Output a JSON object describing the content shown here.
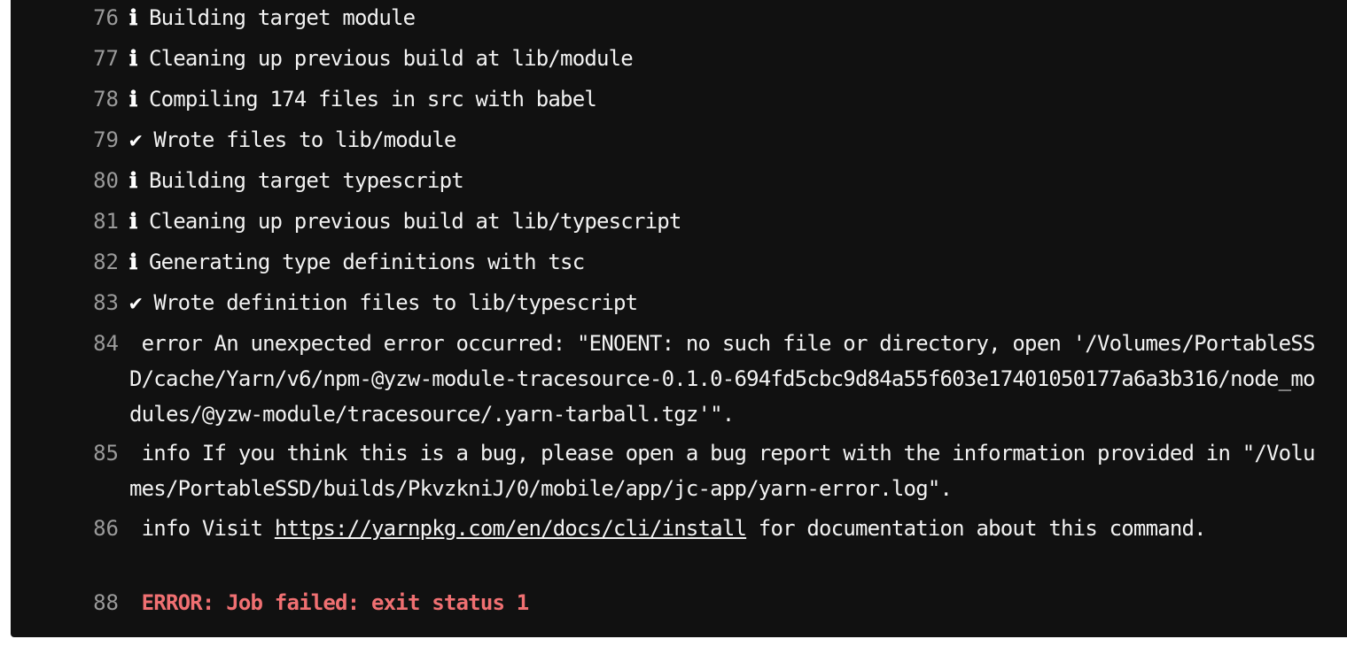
{
  "log": {
    "lines": [
      {
        "num": "76",
        "icon": "ℹ",
        "text": "Building target module"
      },
      {
        "num": "77",
        "icon": "ℹ",
        "text": "Cleaning up previous build at lib/module"
      },
      {
        "num": "78",
        "icon": "ℹ",
        "text": "Compiling 174 files in src with babel"
      },
      {
        "num": "79",
        "icon": "✔",
        "text": "Wrote files to lib/module"
      },
      {
        "num": "80",
        "icon": "ℹ",
        "text": "Building target typescript"
      },
      {
        "num": "81",
        "icon": "ℹ",
        "text": "Cleaning up previous build at lib/typescript"
      },
      {
        "num": "82",
        "icon": "ℹ",
        "text": "Generating type definitions with tsc"
      },
      {
        "num": "83",
        "icon": "✔",
        "text": "Wrote definition files to lib/typescript"
      },
      {
        "num": "84",
        "text": " error An unexpected error occurred: \"ENOENT: no such file or directory, open '/Volumes/PortableSSD/cache/Yarn/v6/npm-@yzw-module-tracesource-0.1.0-694fd5cbc9d84a55f603e17401050177a6a3b316/node_modules/@yzw-module/tracesource/.yarn-tarball.tgz'\"."
      },
      {
        "num": "85",
        "text": " info If you think this is a bug, please open a bug report with the information provided in \"/Volumes/PortableSSD/builds/PkvzkniJ/0/mobile/app/jc-app/yarn-error.log\"."
      },
      {
        "num": "86",
        "prefix": " info Visit ",
        "link": "https://yarnpkg.com/en/docs/cli/install",
        "suffix": " for documentation about this command."
      },
      {
        "num": "88",
        "text": " ERROR: Job failed: exit status 1"
      }
    ]
  },
  "colors": {
    "background": "#111111",
    "text": "#f2f2f2",
    "line_number": "#9a9a9a",
    "error": "#f07072"
  },
  "icons": {
    "info": "info-icon",
    "success": "checkmark-icon"
  }
}
